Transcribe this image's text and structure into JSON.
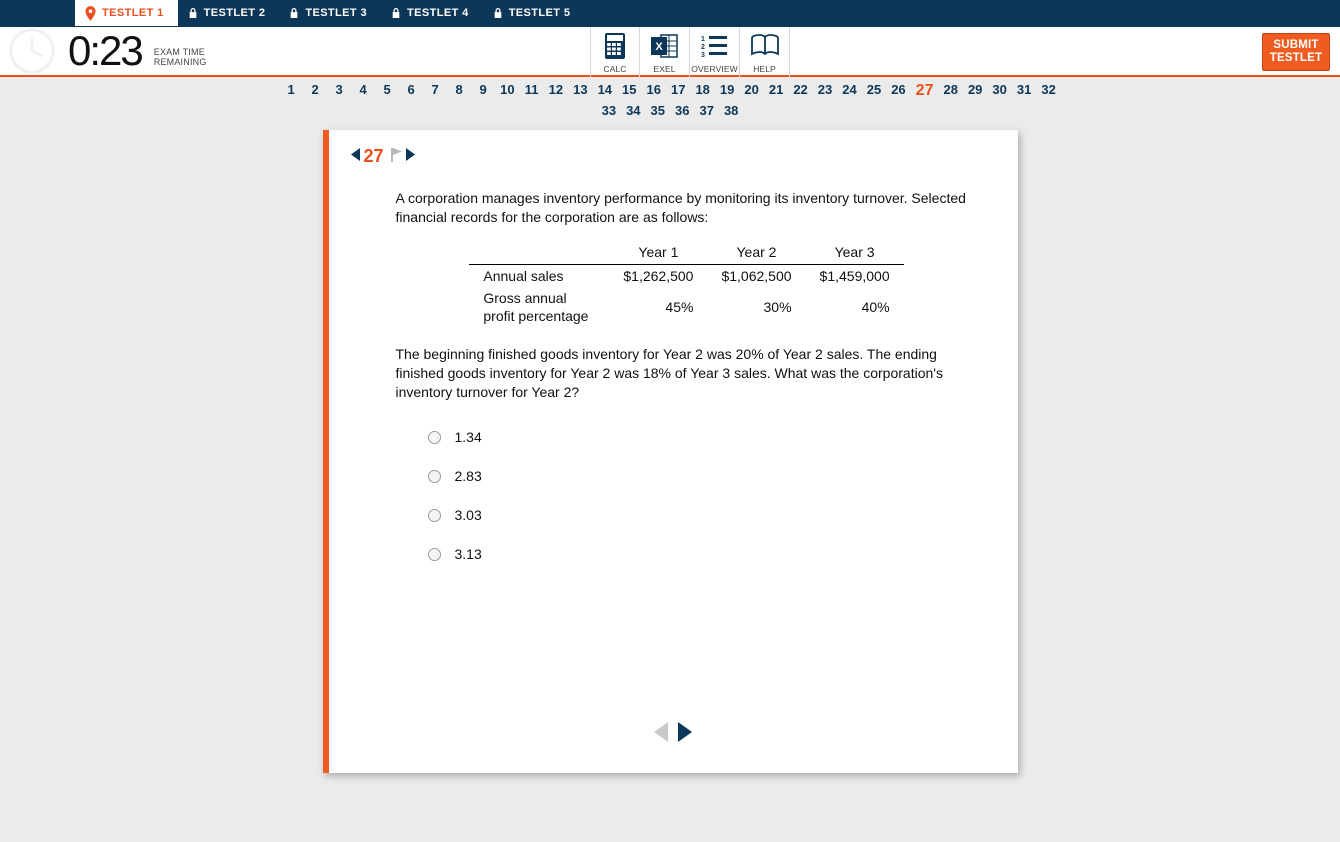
{
  "tabs": [
    {
      "label": "TESTLET 1",
      "active": true
    },
    {
      "label": "TESTLET 2",
      "active": false
    },
    {
      "label": "TESTLET 3",
      "active": false
    },
    {
      "label": "TESTLET 4",
      "active": false
    },
    {
      "label": "TESTLET 5",
      "active": false
    }
  ],
  "timer": {
    "value": "0:23",
    "label_line1": "EXAM TIME",
    "label_line2": "REMAINING"
  },
  "tools": {
    "calc": "CALC",
    "exel": "EXEL",
    "overview": "OVERVIEW",
    "help": "HELP"
  },
  "submit": {
    "line1": "SUBMIT",
    "line2": "TESTLET"
  },
  "questionNav": {
    "row1": [
      "1",
      "2",
      "3",
      "4",
      "5",
      "6",
      "7",
      "8",
      "9",
      "10",
      "11",
      "12",
      "13",
      "14",
      "15",
      "16",
      "17",
      "18",
      "19",
      "20",
      "21",
      "22",
      "23",
      "24",
      "25",
      "26",
      "27",
      "28",
      "29",
      "30",
      "31",
      "32"
    ],
    "row2": [
      "33",
      "34",
      "35",
      "36",
      "37",
      "38"
    ],
    "current": "27"
  },
  "card": {
    "current": "27",
    "para1": "A corporation manages inventory performance by monitoring its inventory turnover. Selected financial records for the corporation are as follows:",
    "table": {
      "headers": [
        "",
        "Year 1",
        "Year 2",
        "Year 3"
      ],
      "rows": [
        {
          "label": "Annual sales",
          "y1": "$1,262,500",
          "y2": "$1,062,500",
          "y3": "$1,459,000"
        },
        {
          "label": "Gross annual profit percentage",
          "y1": "45%",
          "y2": "30%",
          "y3": "40%"
        }
      ]
    },
    "para2": "The beginning finished goods inventory for Year 2 was 20% of Year 2 sales. The ending finished goods inventory for Year 2 was 18% of Year 3 sales. What was the corporation's inventory turnover for Year 2?",
    "options": [
      "1.34",
      "2.83",
      "3.03",
      "3.13"
    ]
  }
}
